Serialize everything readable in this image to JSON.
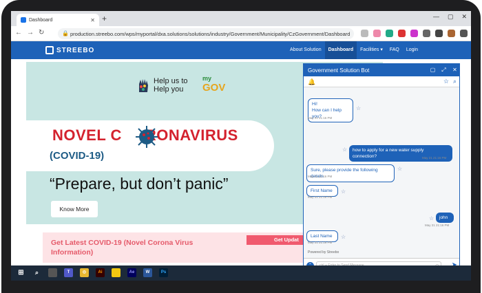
{
  "browser": {
    "tab_title": "Dashboard",
    "new_tab": "+",
    "url": "production.streebo.com/wps/myportal/dxa.solutions/solutions/industry/Government/Municipality/CzGovernment/Dashboard"
  },
  "site": {
    "logo": "STREEBO",
    "nav": [
      {
        "label": "About Solution"
      },
      {
        "label": "Dashboard"
      },
      {
        "label": "Facilities ▾"
      },
      {
        "label": "FAQ"
      },
      {
        "label": "Login"
      }
    ]
  },
  "hero": {
    "help_line1": "Help us to",
    "help_line2": "Help you",
    "mygov_my": "my",
    "mygov_gov": "GOV",
    "novel": "NOVEL C",
    "novel_rest": "RONAVIRUS",
    "covid": "(COVID-19)",
    "tagline": "“Prepare, but don’t panic”",
    "know_more": "Know More"
  },
  "banner": {
    "line1": "Get Latest COVID-19 (Novel Corona Virus",
    "line2": "Information)",
    "button": "Get Updat"
  },
  "chat": {
    "title": "Government Solution Bot",
    "messages": [
      {
        "from": "bot",
        "text1": "Hi!",
        "text2": "How can I help you?",
        "time": "May 21 21:16 PM"
      },
      {
        "from": "user",
        "text1": "how to apply for a new water supply connection?",
        "time": "May 21 21:16 PM"
      },
      {
        "from": "bot",
        "text1": "Sure, please provide the following details",
        "time": "May 21 21:16 PM"
      },
      {
        "from": "bot",
        "text1": "First Name",
        "time": "May 21 21:16 PM"
      },
      {
        "from": "user",
        "text1": "john",
        "time": "May 21 21:16 PM"
      },
      {
        "from": "bot",
        "text1": "Last Name",
        "time": "May 21 21:16 PM"
      }
    ],
    "powered": "Powered by Streebo",
    "input_placeholder": "ctrl + Enter to Send Message ..."
  },
  "colors": {
    "brand_blue": "#1e62b8",
    "covid_red": "#d4222e",
    "hero_bg": "#c8e6e3"
  }
}
